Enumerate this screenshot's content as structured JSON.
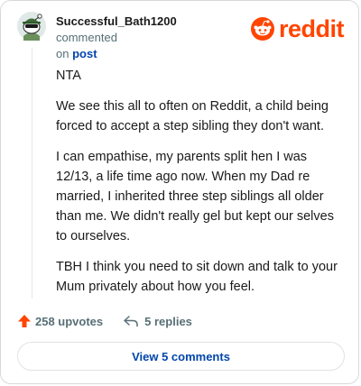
{
  "header": {
    "username": "Successful_Bath1200",
    "commented_text": "commented",
    "on_text": "on",
    "post_link": "post",
    "logo_text": "reddit"
  },
  "comment": {
    "paragraphs": [
      "NTA",
      "We see this all to often on Reddit, a child being forced to accept a step sibling they don't want.",
      "I can empathise, my parents split hen I was 12/13, a life time ago now. When my Dad re married, I inherited three step siblings all older than me. We didn't really gel but kept our selves to ourselves.",
      "TBH I think you need to sit down and talk to your Mum privately about how you feel."
    ]
  },
  "actions": {
    "upvotes_label": "258 upvotes",
    "replies_label": "5 replies"
  },
  "footer": {
    "view_comments_label": "View 5 comments"
  },
  "colors": {
    "brand": "#ff4500",
    "link": "#0045ac",
    "muted": "#576f76"
  },
  "icons": {
    "avatar": "snoo-avatar",
    "logo": "reddit-logo-icon",
    "upvote": "upvote-arrow-icon",
    "reply": "reply-arrow-icon"
  }
}
